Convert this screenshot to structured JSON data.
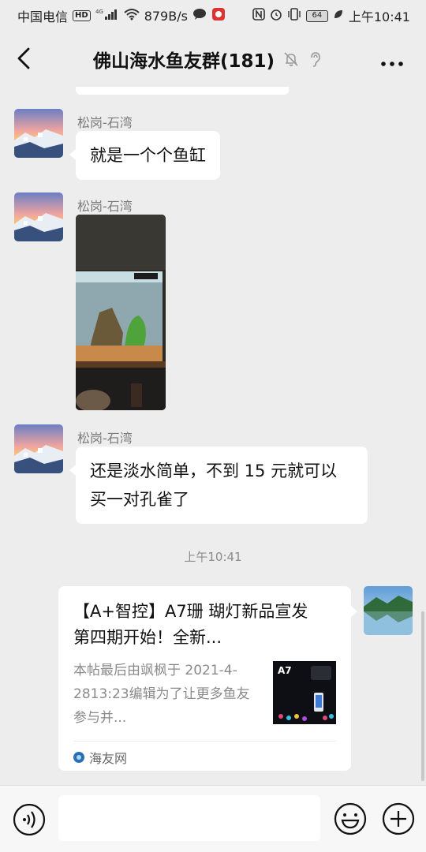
{
  "status_bar": {
    "carrier": "中国电信",
    "hd_badge": "HD",
    "network": "4G",
    "speed": "879B/s",
    "battery": "64",
    "time": "上午10:41"
  },
  "header": {
    "title": "佛山海水鱼友群(181)"
  },
  "messages": [
    {
      "sender": "松岗-石湾",
      "text": "就是一个个鱼缸"
    },
    {
      "sender": "松岗-石湾"
    },
    {
      "sender": "松岗-石湾",
      "text": "还是淡水简单，不到 15 元就可以买一对孔雀了"
    }
  ],
  "timestamp": "上午10:41",
  "link_card": {
    "title": "【A+智控】A7珊 瑚灯新品宣发  第四期开始！全新...",
    "description": "本帖最后由飒枫于 2021-4-2813:23编辑为了让更多鱼友参与并...",
    "thumb_label": "A7",
    "source": "海友网"
  },
  "input": {
    "placeholder": ""
  },
  "colors": {
    "background": "#ededed",
    "bubble": "#ffffff",
    "timestamp": "#8c8c8c",
    "sender": "#7a7a7a"
  },
  "icons": [
    "back-arrow-icon",
    "mute-bell-icon",
    "ear-icon",
    "more-dots-icon",
    "voice-icon",
    "emoji-icon",
    "plus-icon"
  ]
}
